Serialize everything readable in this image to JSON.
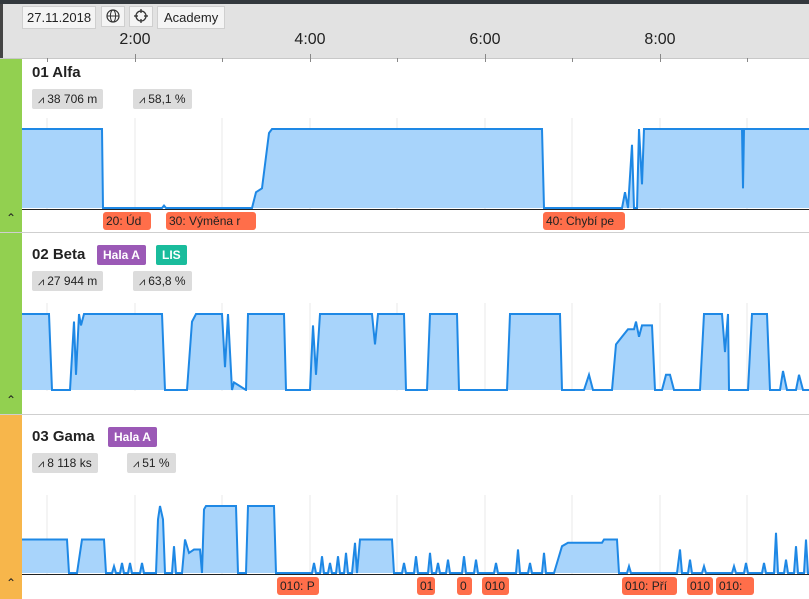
{
  "header": {
    "date": "27.11.2018",
    "location": "Academy",
    "time_labels": [
      "2:00",
      "4:00",
      "6:00",
      "8:00"
    ]
  },
  "colors": {
    "status_green": "#92d050",
    "status_orange": "#f7b64b",
    "chart_fill": "#a8d4fb",
    "chart_line": "#1e88e5",
    "event_bg": "#ff6e4a",
    "badge_purple": "#9b59b6",
    "badge_teal": "#1abc9c"
  },
  "machines": [
    {
      "name": "01 Alfa",
      "stat_length": "38 706 m",
      "stat_oee": "58,1 %",
      "badges": [],
      "events": [
        "20: Úd",
        "30: Výměna r",
        "40: Chybí pe"
      ],
      "timeline": [
        [
          0,
          1
        ],
        [
          80,
          1
        ],
        [
          81,
          0
        ],
        [
          140,
          0
        ],
        [
          142,
          0.03
        ],
        [
          144,
          0
        ],
        [
          230,
          0
        ],
        [
          234,
          0.2
        ],
        [
          240,
          0.25
        ],
        [
          247,
          0.95
        ],
        [
          250,
          1
        ],
        [
          520,
          1
        ],
        [
          522,
          0
        ],
        [
          600,
          0
        ],
        [
          603,
          0.2
        ],
        [
          606,
          0
        ],
        [
          610,
          0.8
        ],
        [
          612,
          0
        ],
        [
          615,
          0
        ],
        [
          617,
          1
        ],
        [
          620,
          0.3
        ],
        [
          622,
          1
        ],
        [
          720,
          1
        ],
        [
          721,
          0.25
        ],
        [
          722,
          1
        ],
        [
          787,
          1
        ]
      ]
    },
    {
      "name": "02 Beta",
      "stat_length": "27 944 m",
      "stat_oee": "63,8 %",
      "badges": [
        "Hala A",
        "LIS"
      ],
      "events": [],
      "timeline": [
        [
          0,
          1
        ],
        [
          27,
          1
        ],
        [
          30,
          0
        ],
        [
          48,
          0
        ],
        [
          52,
          0.9
        ],
        [
          54,
          0.2
        ],
        [
          57,
          1
        ],
        [
          59,
          0.85
        ],
        [
          62,
          1
        ],
        [
          140,
          1
        ],
        [
          143,
          0
        ],
        [
          165,
          0
        ],
        [
          170,
          0.9
        ],
        [
          174,
          1
        ],
        [
          200,
          1
        ],
        [
          203,
          0.3
        ],
        [
          206,
          1
        ],
        [
          210,
          0
        ],
        [
          212,
          0.1
        ],
        [
          224,
          0
        ],
        [
          226,
          1
        ],
        [
          262,
          1
        ],
        [
          264,
          0
        ],
        [
          288,
          0
        ],
        [
          291,
          0.85
        ],
        [
          294,
          0.2
        ],
        [
          298,
          1
        ],
        [
          350,
          1
        ],
        [
          353,
          0.6
        ],
        [
          356,
          1
        ],
        [
          382,
          1
        ],
        [
          384,
          0
        ],
        [
          405,
          0
        ],
        [
          408,
          1
        ],
        [
          435,
          1
        ],
        [
          437,
          0
        ],
        [
          485,
          0
        ],
        [
          488,
          1
        ],
        [
          538,
          1
        ],
        [
          540,
          0
        ],
        [
          562,
          0
        ],
        [
          567,
          0.2
        ],
        [
          571,
          0
        ],
        [
          590,
          0
        ],
        [
          594,
          0.6
        ],
        [
          600,
          0.7
        ],
        [
          606,
          0.8
        ],
        [
          612,
          0.8
        ],
        [
          614,
          0.9
        ],
        [
          617,
          0.7
        ],
        [
          620,
          0.85
        ],
        [
          630,
          0.85
        ],
        [
          633,
          0
        ],
        [
          640,
          0
        ],
        [
          644,
          0.2
        ],
        [
          648,
          0.2
        ],
        [
          652,
          0
        ],
        [
          678,
          0
        ],
        [
          682,
          1
        ],
        [
          700,
          1
        ],
        [
          703,
          0.5
        ],
        [
          706,
          1
        ],
        [
          707,
          0
        ],
        [
          726,
          0
        ],
        [
          730,
          1
        ],
        [
          745,
          1
        ],
        [
          748,
          0
        ],
        [
          758,
          0
        ],
        [
          761,
          0.25
        ],
        [
          765,
          0
        ],
        [
          774,
          0
        ],
        [
          777,
          0.2
        ],
        [
          781,
          0
        ],
        [
          787,
          0
        ]
      ]
    },
    {
      "name": "03 Gama",
      "stat_length": "8 118 ks",
      "stat_oee": "51 %",
      "badges": [
        "Hala A"
      ],
      "events": [
        "010: P",
        "01",
        "0",
        "010",
        "010: Pří",
        "010",
        "010:"
      ],
      "timeline": [
        [
          0,
          0.5
        ],
        [
          45,
          0.5
        ],
        [
          47,
          0
        ],
        [
          55,
          0
        ],
        [
          60,
          0.5
        ],
        [
          82,
          0.5
        ],
        [
          84,
          0
        ],
        [
          90,
          0
        ],
        [
          92,
          0.1
        ],
        [
          94,
          0
        ],
        [
          98,
          0
        ],
        [
          100,
          0.15
        ],
        [
          102,
          0
        ],
        [
          106,
          0
        ],
        [
          108,
          0.15
        ],
        [
          110,
          0
        ],
        [
          118,
          0
        ],
        [
          120,
          0.15
        ],
        [
          122,
          0
        ],
        [
          134,
          0
        ],
        [
          136,
          0.8
        ],
        [
          138,
          1
        ],
        [
          141,
          0.8
        ],
        [
          143,
          0
        ],
        [
          150,
          0
        ],
        [
          152,
          0.4
        ],
        [
          154,
          0
        ],
        [
          160,
          0
        ],
        [
          163,
          0.5
        ],
        [
          167,
          0.3
        ],
        [
          172,
          0.35
        ],
        [
          178,
          0.35
        ],
        [
          180,
          0
        ],
        [
          182,
          0.95
        ],
        [
          184,
          1
        ],
        [
          214,
          1
        ],
        [
          216,
          0
        ],
        [
          224,
          0
        ],
        [
          226,
          1
        ],
        [
          252,
          1
        ],
        [
          254,
          0
        ],
        [
          290,
          0
        ],
        [
          292,
          0.15
        ],
        [
          294,
          0
        ],
        [
          298,
          0
        ],
        [
          300,
          0.25
        ],
        [
          302,
          0
        ],
        [
          306,
          0
        ],
        [
          308,
          0.15
        ],
        [
          310,
          0
        ],
        [
          314,
          0
        ],
        [
          316,
          0.25
        ],
        [
          318,
          0
        ],
        [
          322,
          0
        ],
        [
          324,
          0.3
        ],
        [
          326,
          0
        ],
        [
          330,
          0
        ],
        [
          333,
          0.45
        ],
        [
          335,
          0
        ],
        [
          338,
          0.5
        ],
        [
          370,
          0.5
        ],
        [
          372,
          0
        ],
        [
          380,
          0
        ],
        [
          382,
          0.15
        ],
        [
          384,
          0
        ],
        [
          392,
          0
        ],
        [
          394,
          0.25
        ],
        [
          396,
          0
        ],
        [
          406,
          0
        ],
        [
          408,
          0.3
        ],
        [
          410,
          0
        ],
        [
          414,
          0
        ],
        [
          416,
          0.15
        ],
        [
          418,
          0
        ],
        [
          424,
          0
        ],
        [
          426,
          0.2
        ],
        [
          428,
          0
        ],
        [
          440,
          0
        ],
        [
          442,
          0.25
        ],
        [
          444,
          0
        ],
        [
          452,
          0
        ],
        [
          454,
          0.2
        ],
        [
          456,
          0
        ],
        [
          472,
          0
        ],
        [
          474,
          0.15
        ],
        [
          476,
          0
        ],
        [
          494,
          0
        ],
        [
          496,
          0.35
        ],
        [
          498,
          0
        ],
        [
          506,
          0
        ],
        [
          508,
          0.15
        ],
        [
          510,
          0
        ],
        [
          520,
          0
        ],
        [
          522,
          0.3
        ],
        [
          524,
          0
        ],
        [
          530,
          0
        ],
        [
          532,
          0
        ],
        [
          536,
          0.2
        ],
        [
          540,
          0.4
        ],
        [
          546,
          0.45
        ],
        [
          580,
          0.45
        ],
        [
          582,
          0.5
        ],
        [
          595,
          0.5
        ],
        [
          597,
          0
        ],
        [
          605,
          0
        ],
        [
          607,
          0.1
        ],
        [
          609,
          0
        ],
        [
          650,
          0
        ],
        [
          655,
          0
        ],
        [
          658,
          0.35
        ],
        [
          660,
          0
        ],
        [
          666,
          0
        ],
        [
          668,
          0.2
        ],
        [
          670,
          0
        ],
        [
          680,
          0
        ],
        [
          682,
          0.1
        ],
        [
          684,
          0
        ],
        [
          710,
          0
        ],
        [
          712,
          0.1
        ],
        [
          714,
          0
        ],
        [
          722,
          0
        ],
        [
          724,
          0.15
        ],
        [
          726,
          0
        ],
        [
          740,
          0
        ],
        [
          742,
          0.15
        ],
        [
          744,
          0
        ],
        [
          752,
          0
        ],
        [
          754,
          0.6
        ],
        [
          756,
          0
        ],
        [
          762,
          0
        ],
        [
          764,
          0.2
        ],
        [
          766,
          0
        ],
        [
          772,
          0
        ],
        [
          774,
          0.4
        ],
        [
          776,
          0
        ],
        [
          782,
          0
        ],
        [
          784,
          0.5
        ],
        [
          786,
          0
        ],
        [
          787,
          0
        ]
      ]
    }
  ]
}
